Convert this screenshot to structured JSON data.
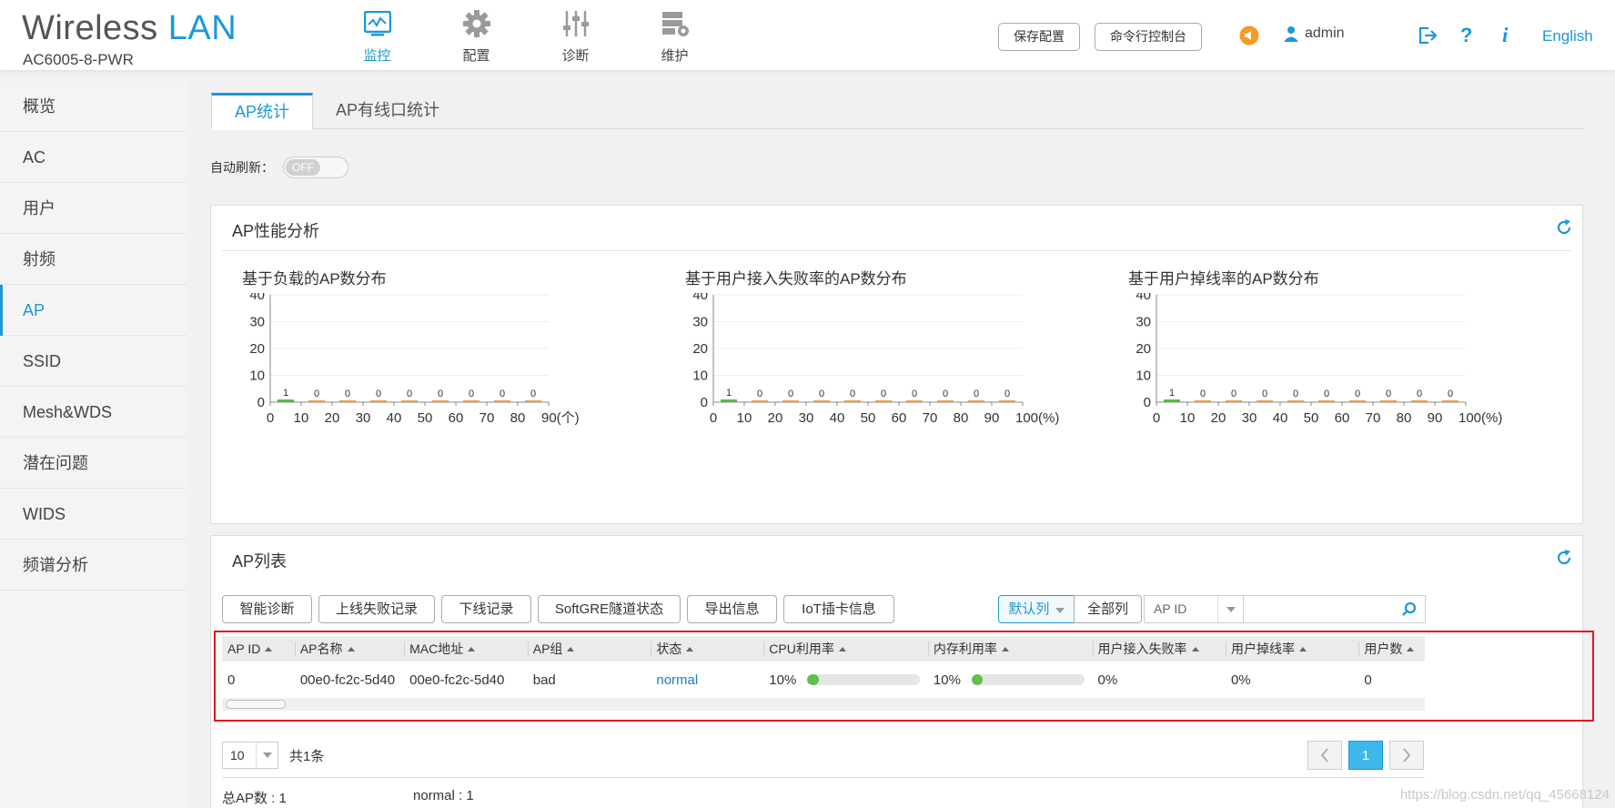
{
  "header": {
    "logo_part1": "Wireless",
    "logo_part2": "LAN",
    "model": "AC6005-8-PWR",
    "nav": [
      {
        "label": "监控",
        "icon": "monitor-icon"
      },
      {
        "label": "配置",
        "icon": "gear-icon"
      },
      {
        "label": "诊断",
        "icon": "sliders-icon"
      },
      {
        "label": "维护",
        "icon": "maintenance-icon"
      }
    ],
    "save_config": "保存配置",
    "cli_console": "命令行控制台",
    "user": "admin",
    "language": "English"
  },
  "sidebar": {
    "items": [
      "概览",
      "AC",
      "用户",
      "射频",
      "AP",
      "SSID",
      "Mesh&WDS",
      "潜在问题",
      "WIDS",
      "频谱分析"
    ],
    "active_index": 4
  },
  "tabs": [
    "AP统计",
    "AP有线口统计"
  ],
  "auto_refresh": {
    "label": "自动刷新：",
    "state": "OFF"
  },
  "performance": {
    "title": "AP性能分析",
    "charts": [
      {
        "title": "基于负载的AP数分布",
        "x_ticks": [
          "0",
          "10",
          "20",
          "30",
          "40",
          "50",
          "60",
          "70",
          "80",
          "90(个)"
        ],
        "y_ticks": [
          "0",
          "10",
          "20",
          "30",
          "40"
        ],
        "values": [
          1,
          0,
          0,
          0,
          0,
          0,
          0,
          0,
          0
        ]
      },
      {
        "title": "基于用户接入失败率的AP数分布",
        "x_ticks": [
          "0",
          "10",
          "20",
          "30",
          "40",
          "50",
          "60",
          "70",
          "80",
          "90",
          "100(%)"
        ],
        "y_ticks": [
          "0",
          "10",
          "20",
          "30",
          "40"
        ],
        "values": [
          1,
          0,
          0,
          0,
          0,
          0,
          0,
          0,
          0,
          0
        ]
      },
      {
        "title": "基于用户掉线率的AP数分布",
        "x_ticks": [
          "0",
          "10",
          "20",
          "30",
          "40",
          "50",
          "60",
          "70",
          "80",
          "90",
          "100(%)"
        ],
        "y_ticks": [
          "0",
          "10",
          "20",
          "30",
          "40"
        ],
        "values": [
          1,
          0,
          0,
          0,
          0,
          0,
          0,
          0,
          0,
          0
        ]
      }
    ]
  },
  "chart_data": [
    {
      "type": "bar",
      "title": "基于负载的AP数分布",
      "categories": [
        "0-10",
        "10-20",
        "20-30",
        "30-40",
        "40-50",
        "50-60",
        "60-70",
        "70-80",
        "80-90"
      ],
      "values": [
        1,
        0,
        0,
        0,
        0,
        0,
        0,
        0,
        0
      ],
      "xlabel": "(个)",
      "ylim": [
        0,
        40
      ]
    },
    {
      "type": "bar",
      "title": "基于用户接入失败率的AP数分布",
      "categories": [
        "0-10",
        "10-20",
        "20-30",
        "30-40",
        "40-50",
        "50-60",
        "60-70",
        "70-80",
        "80-90",
        "90-100"
      ],
      "values": [
        1,
        0,
        0,
        0,
        0,
        0,
        0,
        0,
        0,
        0
      ],
      "xlabel": "(%)",
      "ylim": [
        0,
        40
      ]
    },
    {
      "type": "bar",
      "title": "基于用户掉线率的AP数分布",
      "categories": [
        "0-10",
        "10-20",
        "20-30",
        "30-40",
        "40-50",
        "50-60",
        "60-70",
        "70-80",
        "80-90",
        "90-100"
      ],
      "values": [
        1,
        0,
        0,
        0,
        0,
        0,
        0,
        0,
        0,
        0
      ],
      "xlabel": "(%)",
      "ylim": [
        0,
        40
      ]
    }
  ],
  "ap_list": {
    "title": "AP列表",
    "buttons": [
      "智能诊断",
      "上线失败记录",
      "下线记录",
      "SoftGRE隧道状态",
      "导出信息",
      "IoT插卡信息"
    ],
    "col_default": "默认列",
    "col_all": "全部列",
    "search_field": "AP ID",
    "search_placeholder": "",
    "columns": [
      "AP ID",
      "AP名称",
      "MAC地址",
      "AP组",
      "状态",
      "CPU利用率",
      "内存利用率",
      "用户接入失败率",
      "用户掉线率",
      "用户数"
    ],
    "rows": [
      {
        "ap_id": "0",
        "name": "00e0-fc2c-5d40",
        "mac": "00e0-fc2c-5d40",
        "group": "bad",
        "status": "normal",
        "cpu": "10%",
        "cpu_value": 10,
        "mem": "10%",
        "mem_value": 10,
        "fail_rate": "0%",
        "drop_rate": "0%",
        "users": "0"
      }
    ],
    "page_size": "10",
    "total": "共1条",
    "current_page": "1",
    "total_ap": "总AP数 : 1",
    "normal_count": "normal : 1"
  },
  "watermark": "https://blog.csdn.net/qq_45668124"
}
